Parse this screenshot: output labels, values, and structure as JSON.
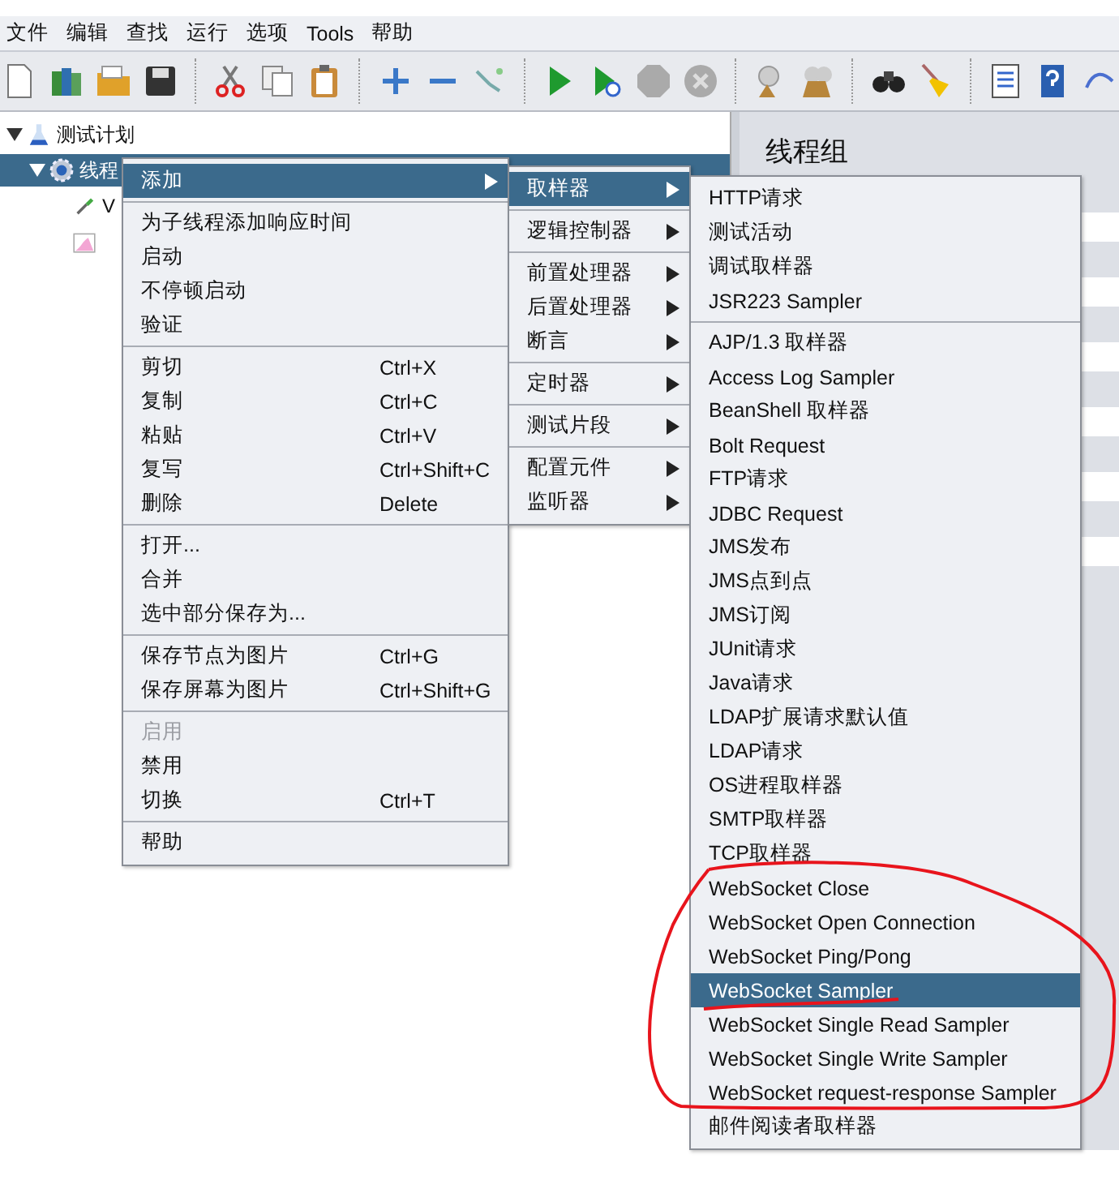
{
  "menubar": [
    {
      "label": "文件"
    },
    {
      "label": "编辑"
    },
    {
      "label": "查找"
    },
    {
      "label": "运行"
    },
    {
      "label": "选项"
    },
    {
      "label": "Tools"
    },
    {
      "label": "帮助"
    }
  ],
  "tree": [
    {
      "label": "测试计划",
      "expanded": true,
      "selected": false,
      "children": [
        {
          "label": "线程",
          "expanded": true,
          "selected": true,
          "children": [
            {
              "label": "V",
              "selected": false
            },
            {
              "selected": false
            }
          ]
        }
      ]
    }
  ],
  "right_panel": {
    "title": "线程组"
  },
  "context_menu": {
    "groups": [
      [
        {
          "label": "添加",
          "submenu": true,
          "selected": true,
          "disabled": false
        }
      ],
      [
        {
          "label": "为子线程添加响应时间",
          "selected": false,
          "disabled": false
        },
        {
          "label": "启动",
          "selected": false,
          "disabled": false
        },
        {
          "label": "不停顿启动",
          "selected": false,
          "disabled": false
        },
        {
          "label": "验证",
          "selected": false,
          "disabled": false
        }
      ],
      [
        {
          "label": "剪切",
          "shortcut": "Ctrl+X",
          "selected": false,
          "disabled": false
        },
        {
          "label": "复制",
          "shortcut": "Ctrl+C",
          "selected": false,
          "disabled": false
        },
        {
          "label": "粘贴",
          "shortcut": "Ctrl+V",
          "selected": false,
          "disabled": false
        },
        {
          "label": "复写",
          "shortcut": "Ctrl+Shift+C",
          "selected": false,
          "disabled": false
        },
        {
          "label": "删除",
          "shortcut": "Delete",
          "selected": false,
          "disabled": false
        }
      ],
      [
        {
          "label": "打开...",
          "selected": false,
          "disabled": false
        },
        {
          "label": "合并",
          "selected": false,
          "disabled": false
        },
        {
          "label": "选中部分保存为...",
          "selected": false,
          "disabled": false
        }
      ],
      [
        {
          "label": "保存节点为图片",
          "shortcut": "Ctrl+G",
          "selected": false,
          "disabled": false
        },
        {
          "label": "保存屏幕为图片",
          "shortcut": "Ctrl+Shift+G",
          "selected": false,
          "disabled": false
        }
      ],
      [
        {
          "label": "启用",
          "selected": false,
          "disabled": true
        },
        {
          "label": "禁用",
          "selected": false,
          "disabled": false
        },
        {
          "label": "切换",
          "shortcut": "Ctrl+T",
          "selected": false,
          "disabled": false
        }
      ],
      [
        {
          "label": "帮助",
          "selected": false,
          "disabled": false
        }
      ]
    ]
  },
  "add_submenu": {
    "groups": [
      [
        {
          "label": "取样器",
          "selected": true
        }
      ],
      [
        {
          "label": "逻辑控制器",
          "selected": false
        }
      ],
      [
        {
          "label": "前置处理器",
          "selected": false
        },
        {
          "label": "后置处理器",
          "selected": false
        },
        {
          "label": "断言",
          "selected": false
        }
      ],
      [
        {
          "label": "定时器",
          "selected": false
        }
      ],
      [
        {
          "label": "测试片段",
          "selected": false
        }
      ],
      [
        {
          "label": "配置元件",
          "selected": false
        },
        {
          "label": "监听器",
          "selected": false
        }
      ]
    ]
  },
  "sampler_submenu": {
    "groups": [
      [
        {
          "label": "HTTP请求",
          "selected": false
        },
        {
          "label": "测试活动",
          "selected": false
        },
        {
          "label": "调试取样器",
          "selected": false
        },
        {
          "label": "JSR223 Sampler",
          "selected": false
        }
      ],
      [
        {
          "label": "AJP/1.3 取样器",
          "selected": false
        },
        {
          "label": "Access Log Sampler",
          "selected": false
        },
        {
          "label": "BeanShell 取样器",
          "selected": false
        },
        {
          "label": "Bolt Request",
          "selected": false
        },
        {
          "label": "FTP请求",
          "selected": false
        },
        {
          "label": "JDBC Request",
          "selected": false
        },
        {
          "label": "JMS发布",
          "selected": false
        },
        {
          "label": "JMS点到点",
          "selected": false
        },
        {
          "label": "JMS订阅",
          "selected": false
        },
        {
          "label": "JUnit请求",
          "selected": false
        },
        {
          "label": "Java请求",
          "selected": false
        },
        {
          "label": "LDAP扩展请求默认值",
          "selected": false
        },
        {
          "label": "LDAP请求",
          "selected": false
        },
        {
          "label": "OS进程取样器",
          "selected": false
        },
        {
          "label": "SMTP取样器",
          "selected": false
        },
        {
          "label": "TCP取样器",
          "selected": false
        },
        {
          "label": "WebSocket Close",
          "selected": false
        },
        {
          "label": "WebSocket Open Connection",
          "selected": false
        },
        {
          "label": "WebSocket Ping/Pong",
          "selected": false
        },
        {
          "label": "WebSocket Sampler",
          "selected": true
        },
        {
          "label": "WebSocket Single Read Sampler",
          "selected": false
        },
        {
          "label": "WebSocket Single Write Sampler",
          "selected": false
        },
        {
          "label": "WebSocket request-response Sampler",
          "selected": false
        },
        {
          "label": "邮件阅读者取样器",
          "selected": false
        }
      ]
    ]
  }
}
